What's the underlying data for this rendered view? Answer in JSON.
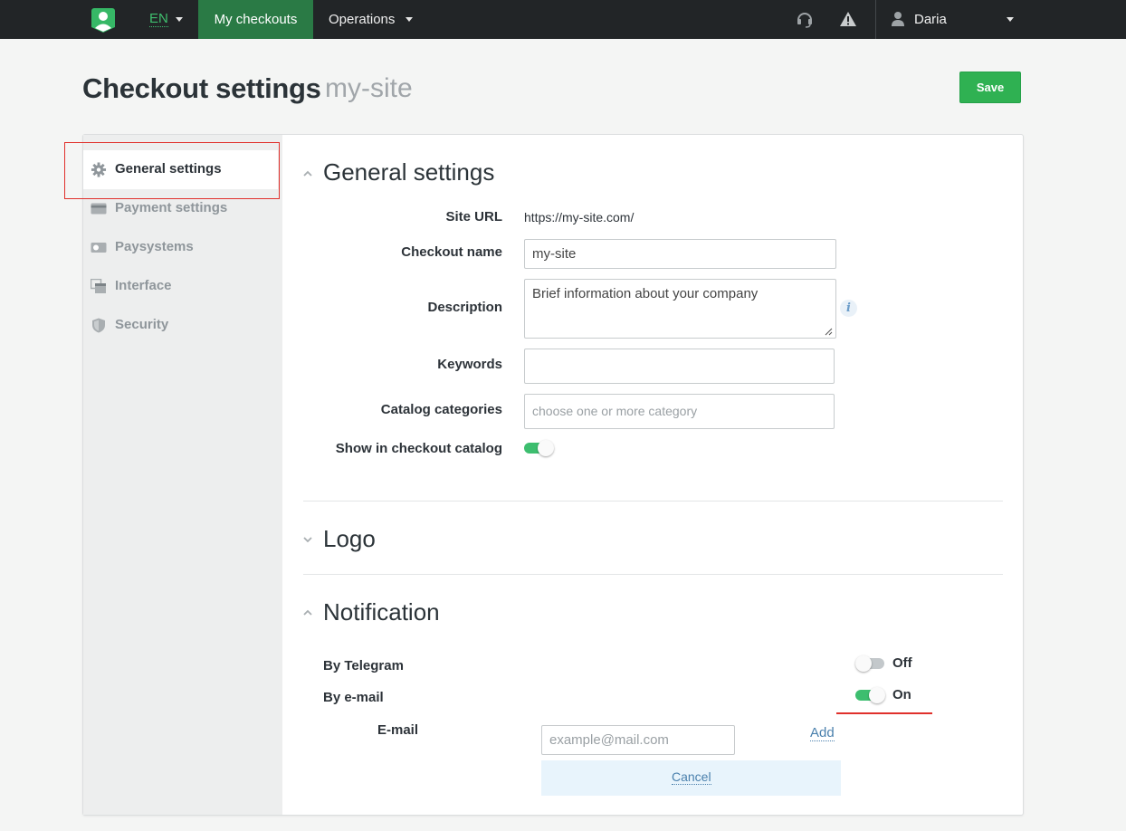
{
  "topbar": {
    "language": "EN",
    "nav": [
      {
        "label": "My checkouts",
        "active": true
      },
      {
        "label": "Operations",
        "active": false
      }
    ],
    "user_name": "Daria",
    "accent_color": "#3fbf6e",
    "active_nav_color": "#2a7a45",
    "icons": [
      "app-logo-icon",
      "headset-icon",
      "warning-icon",
      "user-icon"
    ]
  },
  "header": {
    "title": "Checkout settings",
    "subtitle": "my-site",
    "save_label": "Save",
    "save_color": "#2fb152"
  },
  "sidebar": {
    "items": [
      {
        "label": "General settings",
        "icon": "gear-icon",
        "active": true
      },
      {
        "label": "Payment settings",
        "icon": "card-icon",
        "active": false
      },
      {
        "label": "Paysystems",
        "icon": "cash-icon",
        "active": false
      },
      {
        "label": "Interface",
        "icon": "windows-icon",
        "active": false
      },
      {
        "label": "Security",
        "icon": "shield-icon",
        "active": false
      }
    ]
  },
  "general": {
    "title": "General settings",
    "site_url_label": "Site URL",
    "site_url": "https://my-site.com/",
    "checkout_name_label": "Checkout name",
    "checkout_name": "my-site",
    "description_label": "Description",
    "description": "Brief information about your company",
    "keywords_label": "Keywords",
    "keywords": "",
    "catalog_label": "Catalog categories",
    "catalog_placeholder": "choose one or more category",
    "show_catalog_label": "Show in checkout catalog",
    "show_catalog_on": true
  },
  "logo": {
    "title": "Logo"
  },
  "notification": {
    "title": "Notification",
    "telegram_label": "By Telegram",
    "telegram_state": "Off",
    "email_label": "By e-mail",
    "email_state": "On",
    "email_field_label": "E-mail",
    "email_placeholder": "example@mail.com",
    "add_label": "Add",
    "cancel_label": "Cancel"
  }
}
